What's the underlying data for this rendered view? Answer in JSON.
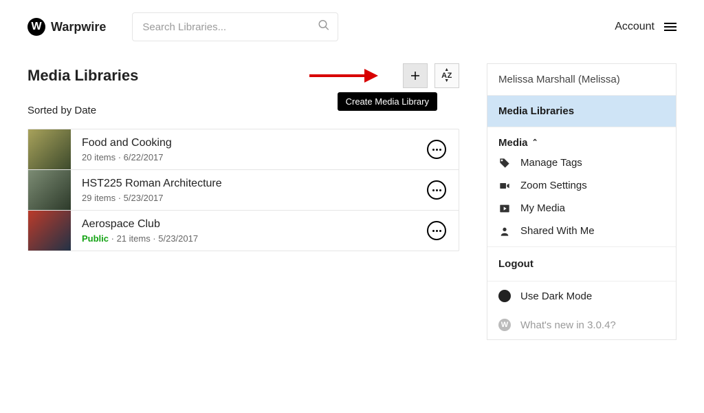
{
  "header": {
    "brand": "Warpwire",
    "search_placeholder": "Search Libraries...",
    "account_label": "Account"
  },
  "main": {
    "title": "Media Libraries",
    "sort_label": "Sorted by Date",
    "add_tooltip": "Create Media Library",
    "sort_btn_label": "AZ",
    "libraries": [
      {
        "name": "Food and Cooking",
        "public": false,
        "meta": "20 items · 6/22/2017"
      },
      {
        "name": "HST225 Roman Architecture",
        "public": false,
        "meta": "29 items · 5/23/2017"
      },
      {
        "name": "Aerospace Club",
        "public": true,
        "public_label": "Public",
        "meta": " · 21 items · 5/23/2017"
      }
    ]
  },
  "sidebar": {
    "user": "Melissa Marshall (Melissa)",
    "active": "Media Libraries",
    "section": "Media",
    "items": [
      {
        "icon": "tag",
        "label": "Manage Tags"
      },
      {
        "icon": "video",
        "label": "Zoom Settings"
      },
      {
        "icon": "play",
        "label": "My Media"
      },
      {
        "icon": "person",
        "label": "Shared With Me"
      }
    ],
    "logout": "Logout",
    "dark_mode": "Use Dark Mode",
    "whats_new": "What's new in 3.0.4?"
  }
}
